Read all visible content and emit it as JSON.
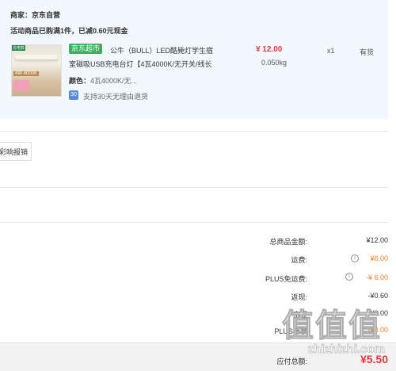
{
  "shop": {
    "label": "商家：",
    "name": "京东自营"
  },
  "promo": "活动商品已购满1件，已减0.60元现金",
  "product": {
    "badge": "京东超市",
    "title_line1": "公牛（BULL）LED酷毙灯学生宿",
    "title_line2": "室磁吸USB充电台灯【4瓦4000K/无开关/线长",
    "thumb_tag": "充电款",
    "thumb_watt": "4W 4000K",
    "price": "¥ 12.00",
    "weight": "0.050kg",
    "qty": "x1",
    "stock": "有货",
    "color_label": "颜色：",
    "color_value": "4瓦4000K/无...",
    "return_icon": "30",
    "return_text": "支持30天无理由退货"
  },
  "invoice_button": "彩响报销",
  "summary": {
    "total_label": "总商品金额:",
    "total_value": "¥12.00",
    "shipping_label": "运费:",
    "shipping_value": "¥6.00",
    "plus_free_label": "PLUS免运费:",
    "plus_free_value": "-¥ 6.00",
    "cashback_label": "返现:",
    "cashback_value": "-¥0.60",
    "row5_label": "京豆",
    "row5_value": "-¥0.00",
    "row6_label": "PLUS专享",
    "row6_value": "-¥0.00",
    "pay_label": "应付总额:",
    "pay_value": "¥5.50"
  },
  "watermark": {
    "big": "值值值",
    "small": "zhizhizhi.com"
  },
  "colors": {
    "accent_red": "#e4393c",
    "accent_orange": "#f47b20",
    "badge_green": "#36b25c"
  }
}
